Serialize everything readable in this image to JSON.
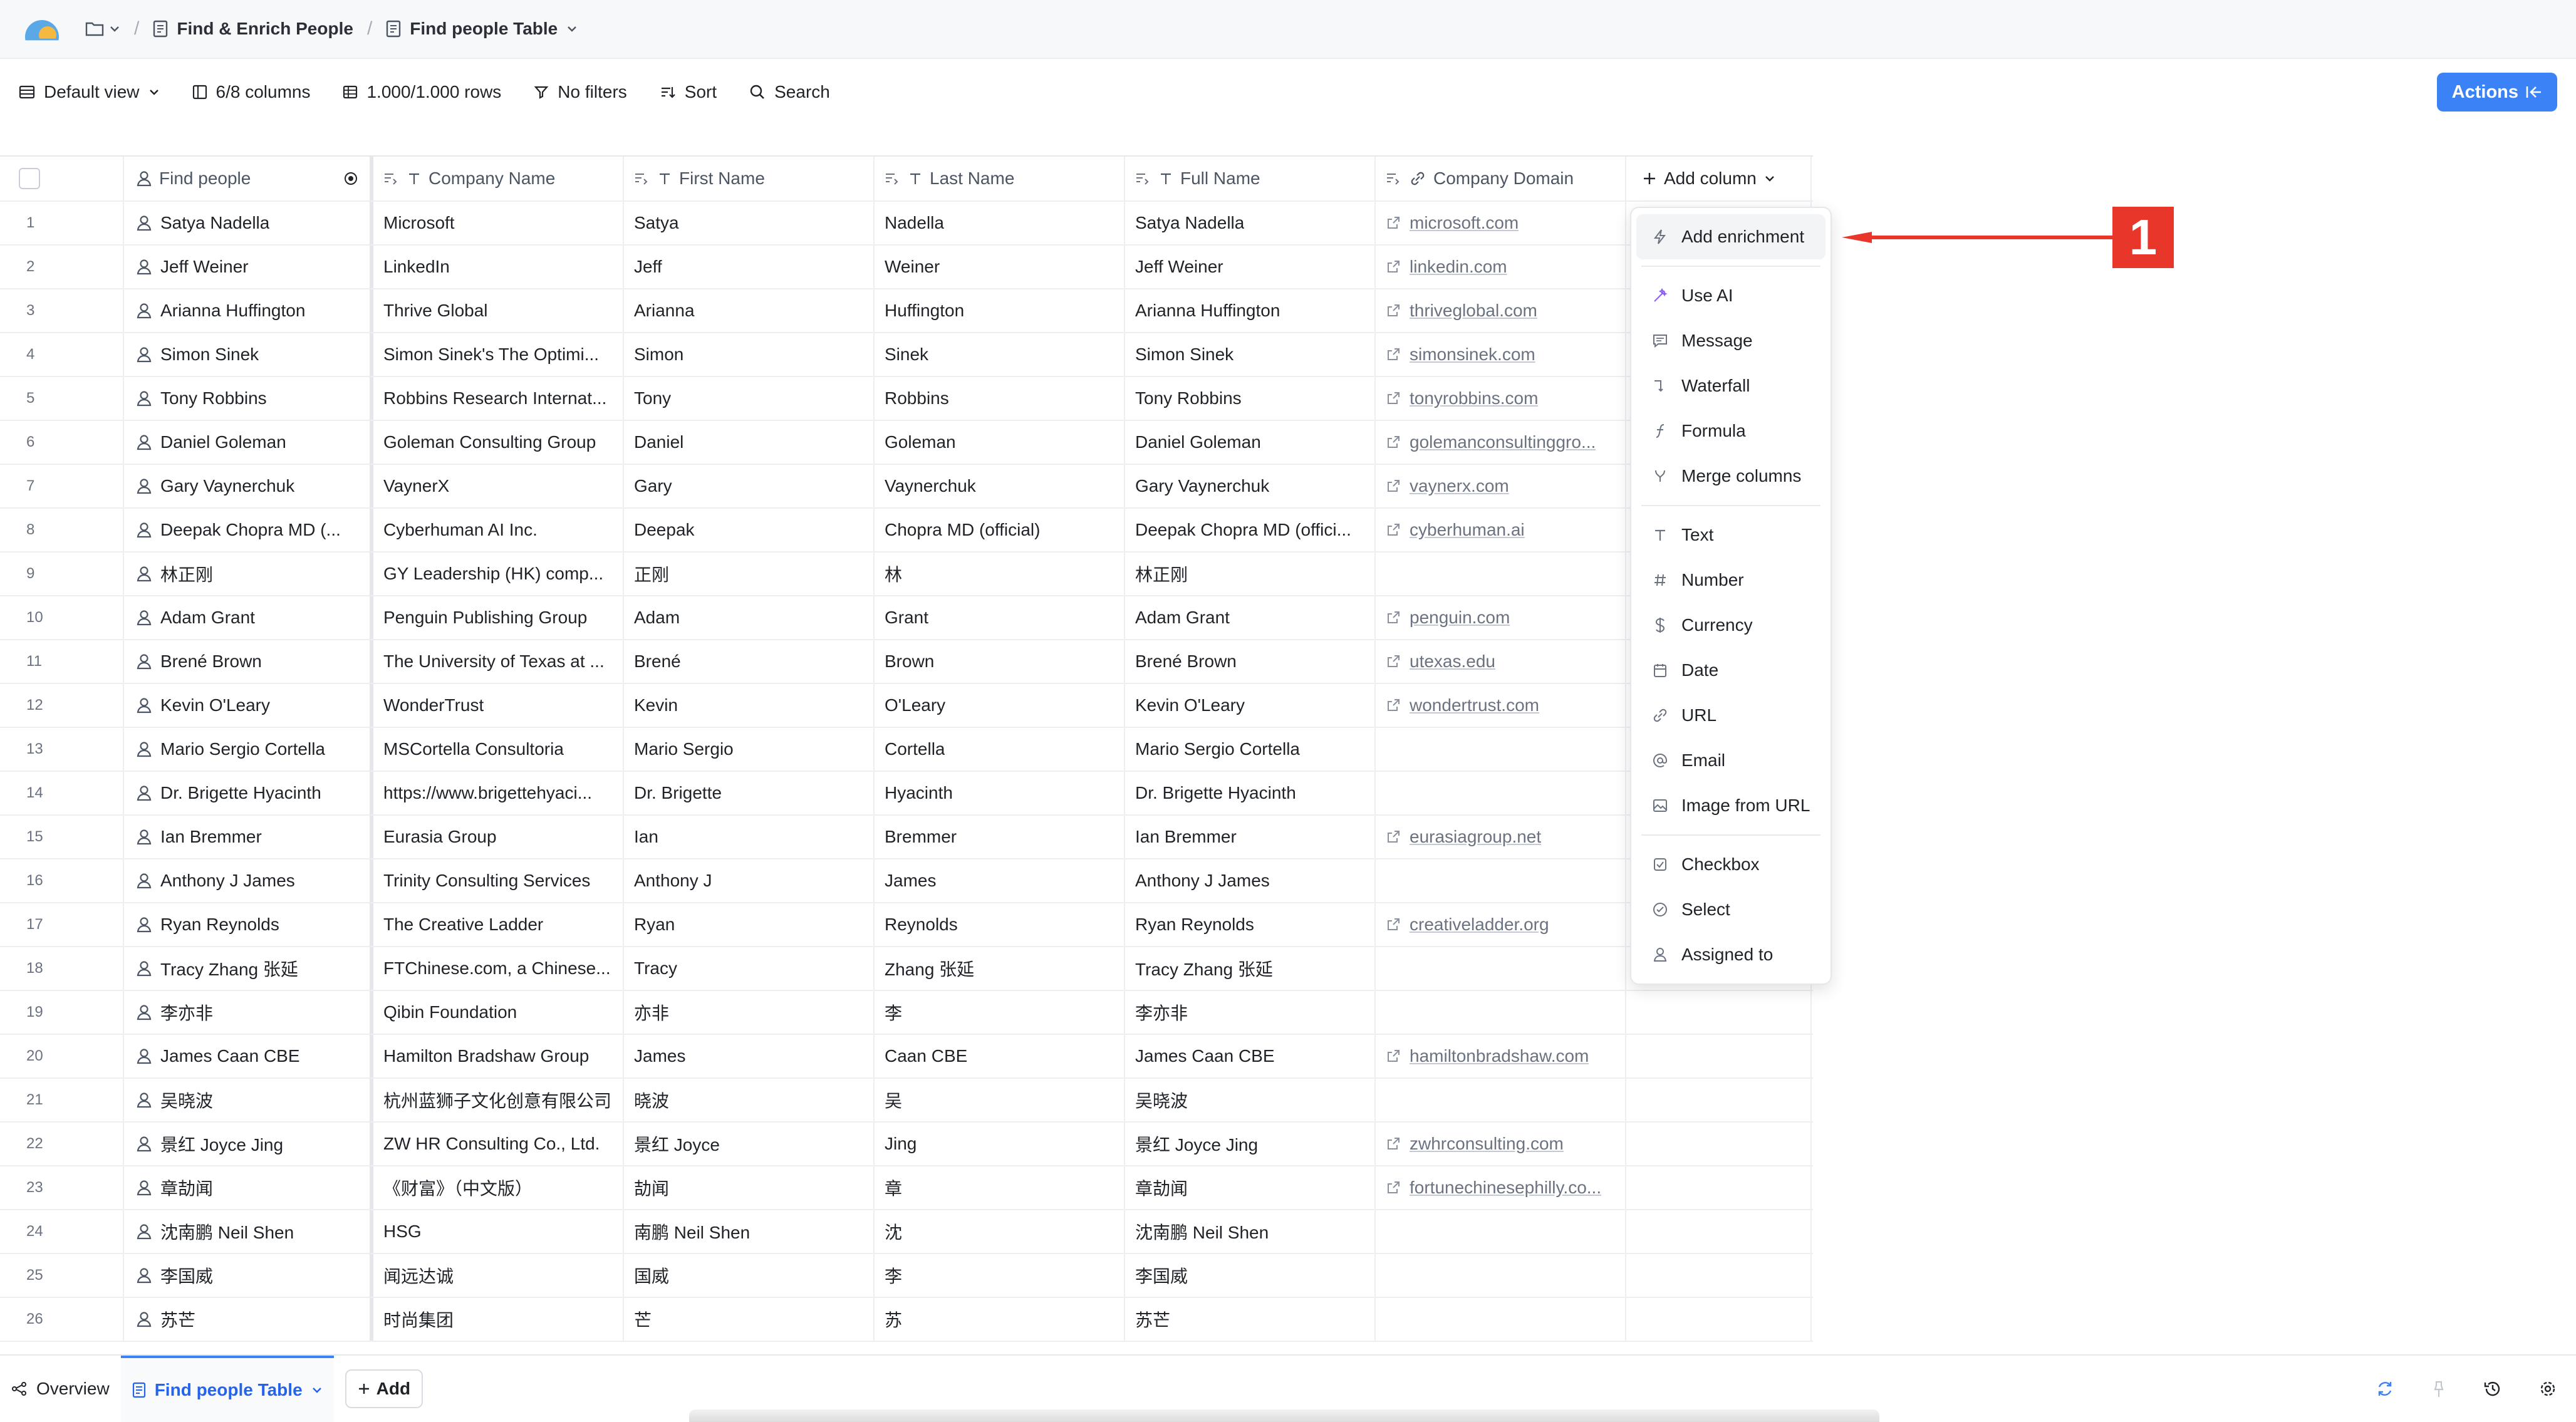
{
  "breadcrumb": {
    "parent": "Find & Enrich People",
    "current": "Find people Table"
  },
  "toolbar": {
    "view": "Default view",
    "columns": "6/8 columns",
    "rows": "1.000/1.000 rows",
    "filters": "No filters",
    "sort": "Sort",
    "search": "Search",
    "actions": "Actions"
  },
  "headers": {
    "find_people": "Find people",
    "company_name": "Company Name",
    "first_name": "First Name",
    "last_name": "Last Name",
    "full_name": "Full Name",
    "company_domain": "Company Domain",
    "add_column": "Add column"
  },
  "rows": [
    {
      "num": "1",
      "person": "Satya Nadella",
      "company": "Microsoft",
      "first": "Satya",
      "last": "Nadella",
      "full": "Satya Nadella",
      "domain": "microsoft.com"
    },
    {
      "num": "2",
      "person": "Jeff Weiner",
      "company": "LinkedIn",
      "first": "Jeff",
      "last": "Weiner",
      "full": "Jeff Weiner",
      "domain": "linkedin.com"
    },
    {
      "num": "3",
      "person": "Arianna Huffington",
      "company": "Thrive Global",
      "first": "Arianna",
      "last": "Huffington",
      "full": "Arianna Huffington",
      "domain": "thriveglobal.com"
    },
    {
      "num": "4",
      "person": "Simon Sinek",
      "company": "Simon Sinek's The Optimi...",
      "first": "Simon",
      "last": "Sinek",
      "full": "Simon Sinek",
      "domain": "simonsinek.com"
    },
    {
      "num": "5",
      "person": "Tony Robbins",
      "company": "Robbins Research Internat...",
      "first": "Tony",
      "last": "Robbins",
      "full": "Tony Robbins",
      "domain": "tonyrobbins.com"
    },
    {
      "num": "6",
      "person": "Daniel Goleman",
      "company": "Goleman Consulting Group",
      "first": "Daniel",
      "last": "Goleman",
      "full": "Daniel Goleman",
      "domain": "golemanconsultinggro..."
    },
    {
      "num": "7",
      "person": "Gary Vaynerchuk",
      "company": "VaynerX",
      "first": "Gary",
      "last": "Vaynerchuk",
      "full": "Gary Vaynerchuk",
      "domain": "vaynerx.com"
    },
    {
      "num": "8",
      "person": "Deepak Chopra MD (...",
      "company": "Cyberhuman AI Inc.",
      "first": "Deepak",
      "last": "Chopra MD (official)",
      "full": "Deepak Chopra MD (offici...",
      "domain": "cyberhuman.ai"
    },
    {
      "num": "9",
      "person": "林正刚",
      "company": "GY Leadership (HK) comp...",
      "first": "正刚",
      "last": "林",
      "full": "林正刚",
      "domain": ""
    },
    {
      "num": "10",
      "person": "Adam Grant",
      "company": "Penguin Publishing Group",
      "first": "Adam",
      "last": "Grant",
      "full": "Adam Grant",
      "domain": "penguin.com"
    },
    {
      "num": "11",
      "person": "Brené Brown",
      "company": "The University of Texas at ...",
      "first": "Brené",
      "last": "Brown",
      "full": "Brené Brown",
      "domain": "utexas.edu"
    },
    {
      "num": "12",
      "person": "Kevin O'Leary",
      "company": "WonderTrust",
      "first": "Kevin",
      "last": "O'Leary",
      "full": "Kevin O'Leary",
      "domain": "wondertrust.com"
    },
    {
      "num": "13",
      "person": "Mario Sergio Cortella",
      "company": "MSCortella Consultoria",
      "first": "Mario Sergio",
      "last": "Cortella",
      "full": "Mario Sergio Cortella",
      "domain": ""
    },
    {
      "num": "14",
      "person": "Dr. Brigette Hyacinth",
      "company": "https://www.brigettehyaci...",
      "first": "Dr. Brigette",
      "last": "Hyacinth",
      "full": "Dr. Brigette Hyacinth",
      "domain": ""
    },
    {
      "num": "15",
      "person": "Ian Bremmer",
      "company": "Eurasia Group",
      "first": "Ian",
      "last": "Bremmer",
      "full": "Ian Bremmer",
      "domain": "eurasiagroup.net"
    },
    {
      "num": "16",
      "person": "Anthony J James",
      "company": "Trinity Consulting Services",
      "first": "Anthony J",
      "last": "James",
      "full": "Anthony J James",
      "domain": ""
    },
    {
      "num": "17",
      "person": "Ryan Reynolds",
      "company": "The Creative Ladder",
      "first": "Ryan",
      "last": "Reynolds",
      "full": "Ryan Reynolds",
      "domain": "creativeladder.org"
    },
    {
      "num": "18",
      "person": "Tracy Zhang 张延",
      "company": "FTChinese.com, a Chinese...",
      "first": "Tracy",
      "last": "Zhang 张延",
      "full": "Tracy Zhang 张延",
      "domain": ""
    },
    {
      "num": "19",
      "person": "李亦非",
      "company": "Qibin Foundation",
      "first": "亦非",
      "last": "李",
      "full": "李亦非",
      "domain": ""
    },
    {
      "num": "20",
      "person": "James Caan CBE",
      "company": "Hamilton Bradshaw Group",
      "first": "James",
      "last": "Caan CBE",
      "full": "James Caan CBE",
      "domain": "hamiltonbradshaw.com"
    },
    {
      "num": "21",
      "person": "吴晓波",
      "company": "杭州蓝狮子文化创意有限公司",
      "first": "晓波",
      "last": "吴",
      "full": "吴晓波",
      "domain": ""
    },
    {
      "num": "22",
      "person": "景红 Joyce Jing",
      "company": "ZW HR Consulting Co., Ltd.",
      "first": "景红 Joyce",
      "last": "Jing",
      "full": "景红 Joyce Jing",
      "domain": "zwhrconsulting.com"
    },
    {
      "num": "23",
      "person": "章劼闻",
      "company": "《财富》（中文版）",
      "first": "劼闻",
      "last": "章",
      "full": "章劼闻",
      "domain": "fortunechinesephilly.co..."
    },
    {
      "num": "24",
      "person": "沈南鹏 Neil Shen",
      "company": "HSG",
      "first": "南鹏 Neil Shen",
      "last": "沈",
      "full": "沈南鹏 Neil Shen",
      "domain": ""
    },
    {
      "num": "25",
      "person": "李国威",
      "company": "闻远达诚",
      "first": "国威",
      "last": "李",
      "full": "李国威",
      "domain": ""
    },
    {
      "num": "26",
      "person": "苏芒",
      "company": "时尚集团",
      "first": "芒",
      "last": "苏",
      "full": "苏芒",
      "domain": ""
    }
  ],
  "menu": {
    "group1": [
      {
        "label": "Add enrichment",
        "icon": "bolt-icon"
      }
    ],
    "group2": [
      {
        "label": "Use AI",
        "icon": "wand-icon"
      },
      {
        "label": "Message",
        "icon": "message-icon"
      },
      {
        "label": "Waterfall",
        "icon": "waterfall-icon"
      },
      {
        "label": "Formula",
        "icon": "function-icon"
      },
      {
        "label": "Merge columns",
        "icon": "merge-icon"
      }
    ],
    "group3": [
      {
        "label": "Text",
        "icon": "text-icon"
      },
      {
        "label": "Number",
        "icon": "hash-icon"
      },
      {
        "label": "Currency",
        "icon": "dollar-icon"
      },
      {
        "label": "Date",
        "icon": "calendar-icon"
      },
      {
        "label": "URL",
        "icon": "link-icon"
      },
      {
        "label": "Email",
        "icon": "at-icon"
      },
      {
        "label": "Image from URL",
        "icon": "image-icon"
      }
    ],
    "group4": [
      {
        "label": "Checkbox",
        "icon": "checkbox-icon"
      },
      {
        "label": "Select",
        "icon": "select-icon"
      },
      {
        "label": "Assigned to",
        "icon": "person-icon"
      }
    ]
  },
  "annotation": {
    "badge": "1",
    "color": "#e8362b"
  },
  "bottom": {
    "overview": "Overview",
    "table_tab": "Find people Table",
    "add": "Add"
  },
  "colors": {
    "accent": "#3b82f6",
    "annotation": "#e8362b"
  }
}
